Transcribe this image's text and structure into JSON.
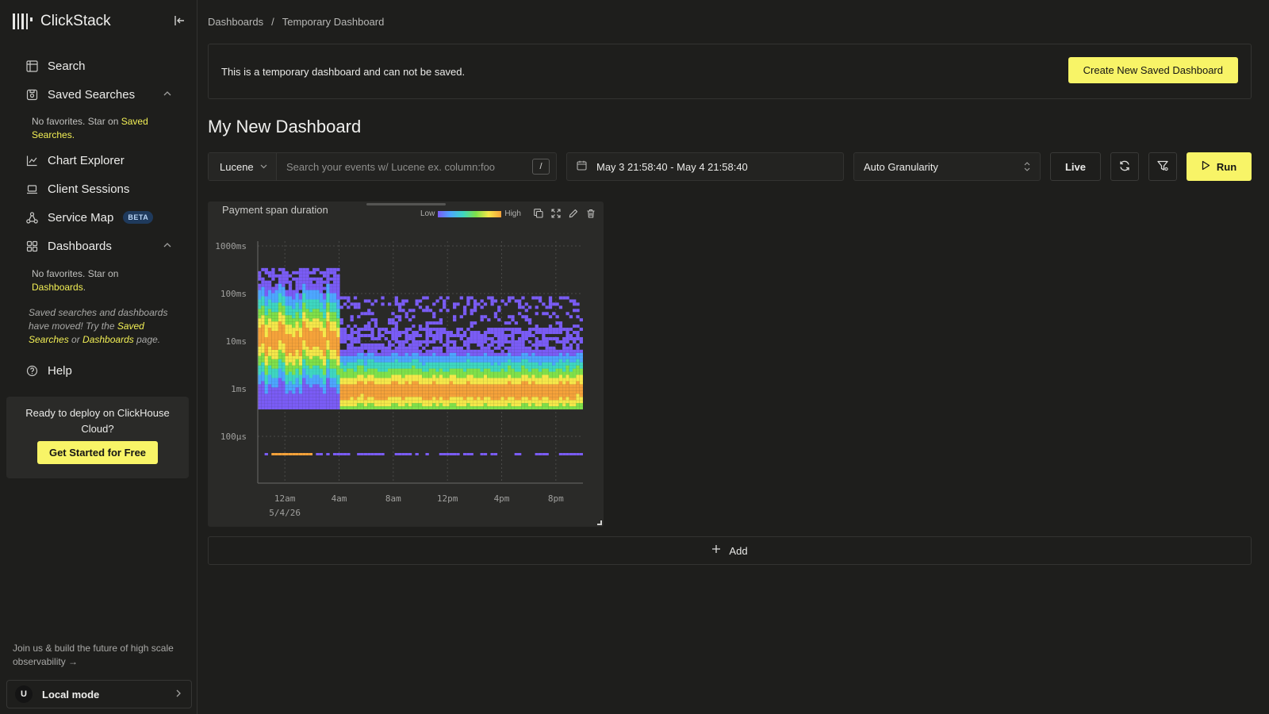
{
  "app": {
    "name": "ClickStack"
  },
  "sidebar": {
    "nav": {
      "search": "Search",
      "saved_searches": "Saved Searches",
      "chart_explorer": "Chart Explorer",
      "client_sessions": "Client Sessions",
      "service_map": "Service Map",
      "service_map_badge": "BETA",
      "dashboards": "Dashboards",
      "help": "Help"
    },
    "saved_searches_note": {
      "prefix": "No favorites. Star on ",
      "link": "Saved Searches",
      "suffix": "."
    },
    "dashboards_note": {
      "prefix": "No favorites. Star on ",
      "link": "Dashboards",
      "suffix": "."
    },
    "moved_note": {
      "text1": "Saved searches and dashboards have moved! Try the ",
      "link1": "Saved Searches",
      "text2": " or ",
      "link2": "Dashboards",
      "text3": " page."
    },
    "deploy": {
      "text": "Ready to deploy on ClickHouse Cloud?",
      "button": "Get Started for Free"
    },
    "join_text": "Join us & build the future of high scale observability →",
    "user": {
      "initial": "U",
      "label": "Local mode"
    }
  },
  "breadcrumb": {
    "parent": "Dashboards",
    "separator": "/",
    "current": "Temporary Dashboard"
  },
  "banner": {
    "text": "This is a temporary dashboard and can not be saved.",
    "button": "Create New Saved Dashboard"
  },
  "dashboard": {
    "title": "My New Dashboard"
  },
  "toolbar": {
    "query_language": "Lucene",
    "search_placeholder": "Search your events w/ Lucene ex. column:foo",
    "shortcut": "/",
    "time_range": "May 3 21:58:40 - May 4 21:58:40",
    "granularity": "Auto Granularity",
    "live_label": "Live",
    "run_label": "Run"
  },
  "tile": {
    "title": "Payment span duration",
    "legend_low": "Low",
    "legend_high": "High"
  },
  "add_label": "Add",
  "colors": {
    "accent": "#f8f467",
    "background": "#1e1e1c",
    "heatmap_scale": [
      "#7a5cf5",
      "#4da6ff",
      "#3ed6c0",
      "#7fe04a",
      "#f5e84a",
      "#f5a23a"
    ]
  },
  "chart_data": {
    "type": "heatmap",
    "title": "Payment span duration",
    "y_scale": "log",
    "y_ticks": [
      "1000ms",
      "100ms",
      "10ms",
      "1ms",
      "100µs"
    ],
    "x_ticks": [
      "12am",
      "4am",
      "8am",
      "12pm",
      "4pm",
      "8pm"
    ],
    "x_sublabel": "5/4/26",
    "legend": {
      "low": "Low",
      "high": "High"
    },
    "time_range": "May 3 21:58:40 - May 4 21:58:40",
    "segments": [
      {
        "from": "22:00",
        "to": "03:59",
        "peak": "10ms",
        "spread": [
          "100µs",
          "1000ms"
        ]
      },
      {
        "from": "04:00",
        "to": "21:58",
        "peak": "1ms",
        "spread": [
          "100µs",
          "100ms"
        ]
      }
    ]
  }
}
